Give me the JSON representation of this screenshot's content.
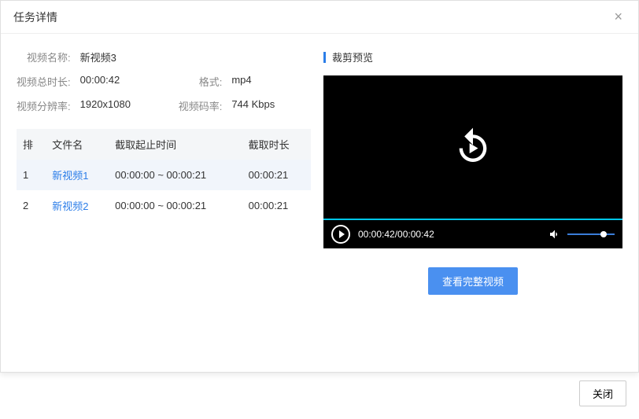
{
  "dialog": {
    "title": "任务详情"
  },
  "info": {
    "name_label": "视频名称:",
    "name": "新视频3",
    "duration_label": "视频总时长:",
    "duration": "00:00:42",
    "format_label": "格式:",
    "format": "mp4",
    "res_label": "视频分辨率:",
    "res": "1920x1080",
    "bitrate_label": "视频码率:",
    "bitrate": "744 Kbps"
  },
  "table": {
    "headers": {
      "idx": "排",
      "name": "文件名",
      "range": "截取起止时间",
      "dur": "截取时长"
    },
    "rows": [
      {
        "idx": "1",
        "name": "新视频1",
        "range": "00:00:00 ~ 00:00:21",
        "dur": "00:00:21"
      },
      {
        "idx": "2",
        "name": "新视频2",
        "range": "00:00:00 ~ 00:00:21",
        "dur": "00:00:21"
      }
    ]
  },
  "preview": {
    "title": "裁剪预览",
    "time": "00:00:42/00:00:42",
    "full_btn": "查看完整视频"
  },
  "footer": {
    "close": "关闭"
  }
}
